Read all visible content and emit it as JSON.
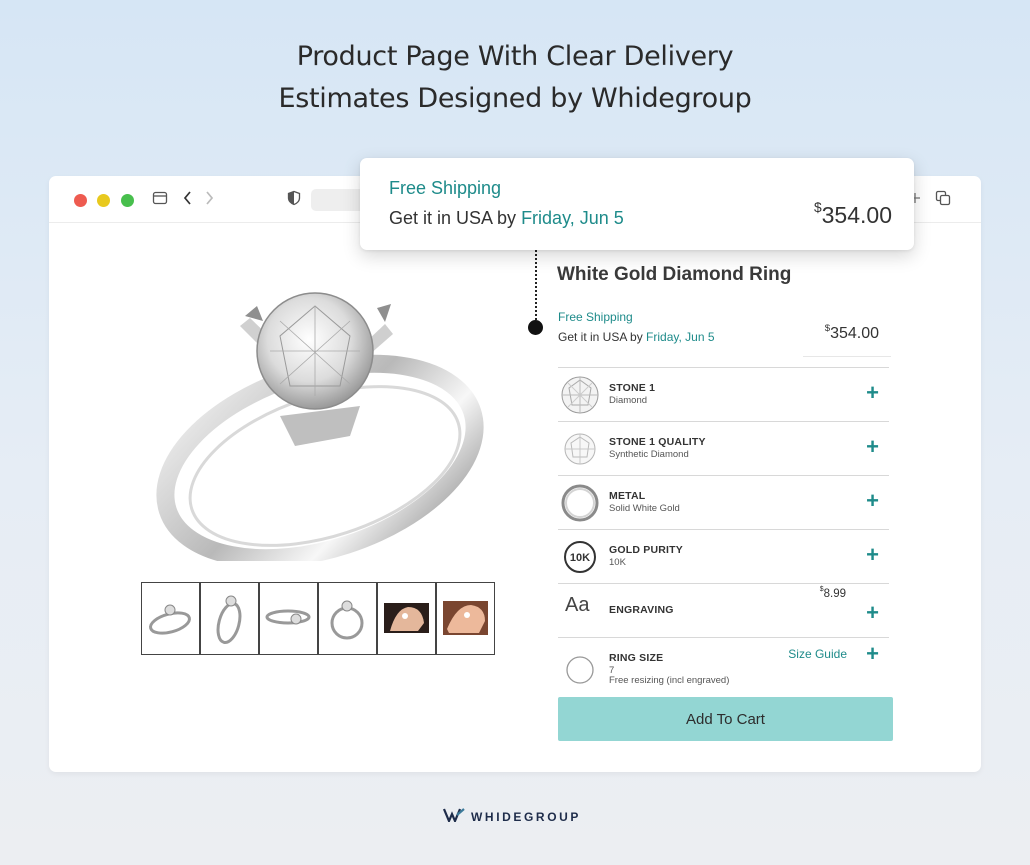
{
  "headline": {
    "line1": "Product Page With Clear Delivery",
    "line2": "Estimates Designed by Whidegroup"
  },
  "browser": {
    "icons": [
      "sidebar-icon",
      "back-icon",
      "forward-icon",
      "shield-icon",
      "new-tab-icon",
      "tabs-icon"
    ]
  },
  "popup": {
    "shipping": "Free Shipping",
    "estimate_prefix": "Get it in USA by ",
    "estimate_date": "Friday, Jun 5",
    "currency": "$",
    "price": "354.00"
  },
  "product": {
    "title": "White Gold Diamond Ring",
    "shipping": "Free Shipping",
    "estimate_prefix": "Get it in USA by ",
    "estimate_date": "Friday, Jun 5",
    "currency": "$",
    "price": "354.00",
    "thumbnail_count": 6
  },
  "options": [
    {
      "name": "STONE 1",
      "value": "Diamond",
      "icon": "diamond-icon"
    },
    {
      "name": "STONE 1 QUALITY",
      "value": "Synthetic Diamond",
      "icon": "diamond-icon"
    },
    {
      "name": "METAL",
      "value": "Solid White Gold",
      "icon": "ring-metal-icon"
    },
    {
      "name": "GOLD PURITY",
      "value": "10K",
      "icon": "purity-badge-icon"
    },
    {
      "name": "ENGRAVING",
      "glyph": "Aa",
      "currency": "$",
      "price": "8.99",
      "icon": "engraving-icon"
    },
    {
      "name": "RING SIZE",
      "value": "7",
      "note": "Free resizing (incl engraved)",
      "link": "Size Guide",
      "icon": "ring-size-icon"
    }
  ],
  "cart_button": "Add To Cart",
  "brand": {
    "name": "WHIDEGROUP"
  },
  "colors": {
    "accent": "#1e8b8a",
    "cart_button": "#93d6d3",
    "traffic_red": "#ee5b50",
    "traffic_yellow": "#e8c91e",
    "traffic_green": "#48bf4d"
  }
}
